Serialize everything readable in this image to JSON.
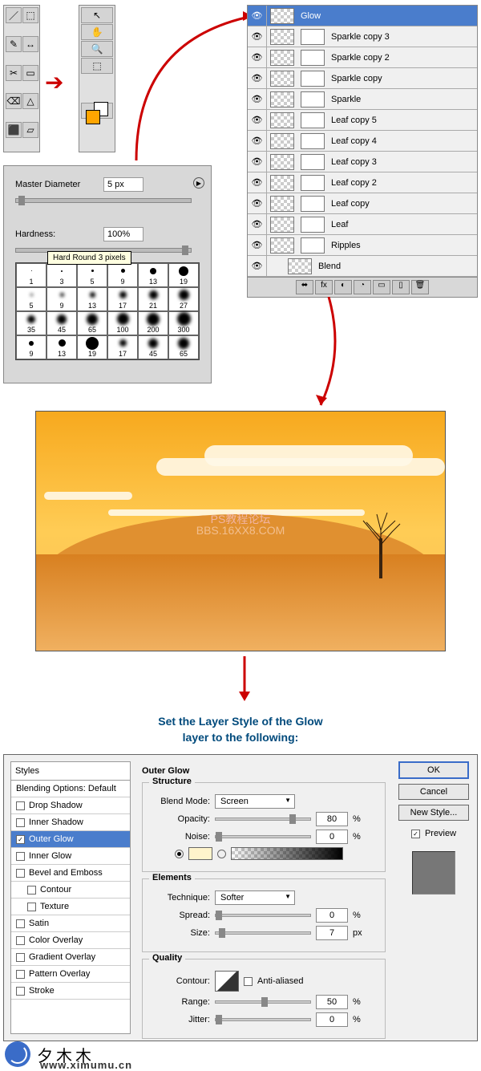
{
  "toolsLeft": [
    "✓",
    "⬚",
    "✎",
    "⬌",
    "✂",
    "▭",
    "⌫",
    "△",
    "⬛",
    "▱"
  ],
  "toolsRight": [
    "↖",
    "✋",
    "🔍",
    "⬚"
  ],
  "brush": {
    "diameterLabel": "Master Diameter",
    "diameterValue": "5 px",
    "hardnessLabel": "Hardness:",
    "hardnessValue": "100%",
    "tooltip": "Hard Round 3 pixels",
    "cells": [
      "1",
      "3",
      "5",
      "9",
      "13",
      "19",
      "5",
      "9",
      "13",
      "17",
      "21",
      "27",
      "35",
      "45",
      "65",
      "100",
      "200",
      "300",
      "9",
      "13",
      "19",
      "17",
      "45",
      "65"
    ]
  },
  "layers": {
    "items": [
      "Glow",
      "Sparkle copy 3",
      "Sparkle copy 2",
      "Sparkle copy",
      "Sparkle",
      "Leaf copy 5",
      "Leaf copy 4",
      "Leaf copy 3",
      "Leaf copy 2",
      "Leaf copy",
      "Leaf",
      "Ripples",
      "Blend"
    ],
    "footer": [
      "⬌",
      "fx",
      "◐",
      "◔",
      "▭",
      "▯",
      "🗑"
    ]
  },
  "preview": {
    "wm1": "PS教程论坛",
    "wm2": "BBS.16XX8.COM"
  },
  "caption": {
    "l1": "Set the Layer Style of the Glow",
    "l2": "layer to the following:"
  },
  "dialog": {
    "title": "Outer Glow",
    "stylesHdr": "Styles",
    "blendingDefault": "Blending Options: Default",
    "styles": [
      "Drop Shadow",
      "Inner Shadow",
      "Outer Glow",
      "Inner Glow",
      "Bevel and Emboss",
      "Contour",
      "Texture",
      "Satin",
      "Color Overlay",
      "Gradient Overlay",
      "Pattern Overlay",
      "Stroke"
    ],
    "structure": {
      "heading": "Structure",
      "blendModeLabel": "Blend Mode:",
      "blendModeValue": "Screen",
      "opacityLabel": "Opacity:",
      "opacityValue": "80",
      "noiseLabel": "Noise:",
      "noiseValue": "0",
      "pct": "%"
    },
    "elements": {
      "heading": "Elements",
      "techLabel": "Technique:",
      "techValue": "Softer",
      "spreadLabel": "Spread:",
      "spreadValue": "0",
      "sizeLabel": "Size:",
      "sizeValue": "7",
      "px": "px",
      "pct": "%"
    },
    "quality": {
      "heading": "Quality",
      "contourLabel": "Contour:",
      "antiLabel": "Anti-aliased",
      "rangeLabel": "Range:",
      "rangeValue": "50",
      "jitterLabel": "Jitter:",
      "jitterValue": "0",
      "pct": "%"
    },
    "buttons": {
      "ok": "OK",
      "cancel": "Cancel",
      "newStyle": "New Style...",
      "preview": "Preview"
    }
  },
  "footer": {
    "chars": "夕木木",
    "url": "www.ximumu.cn"
  }
}
